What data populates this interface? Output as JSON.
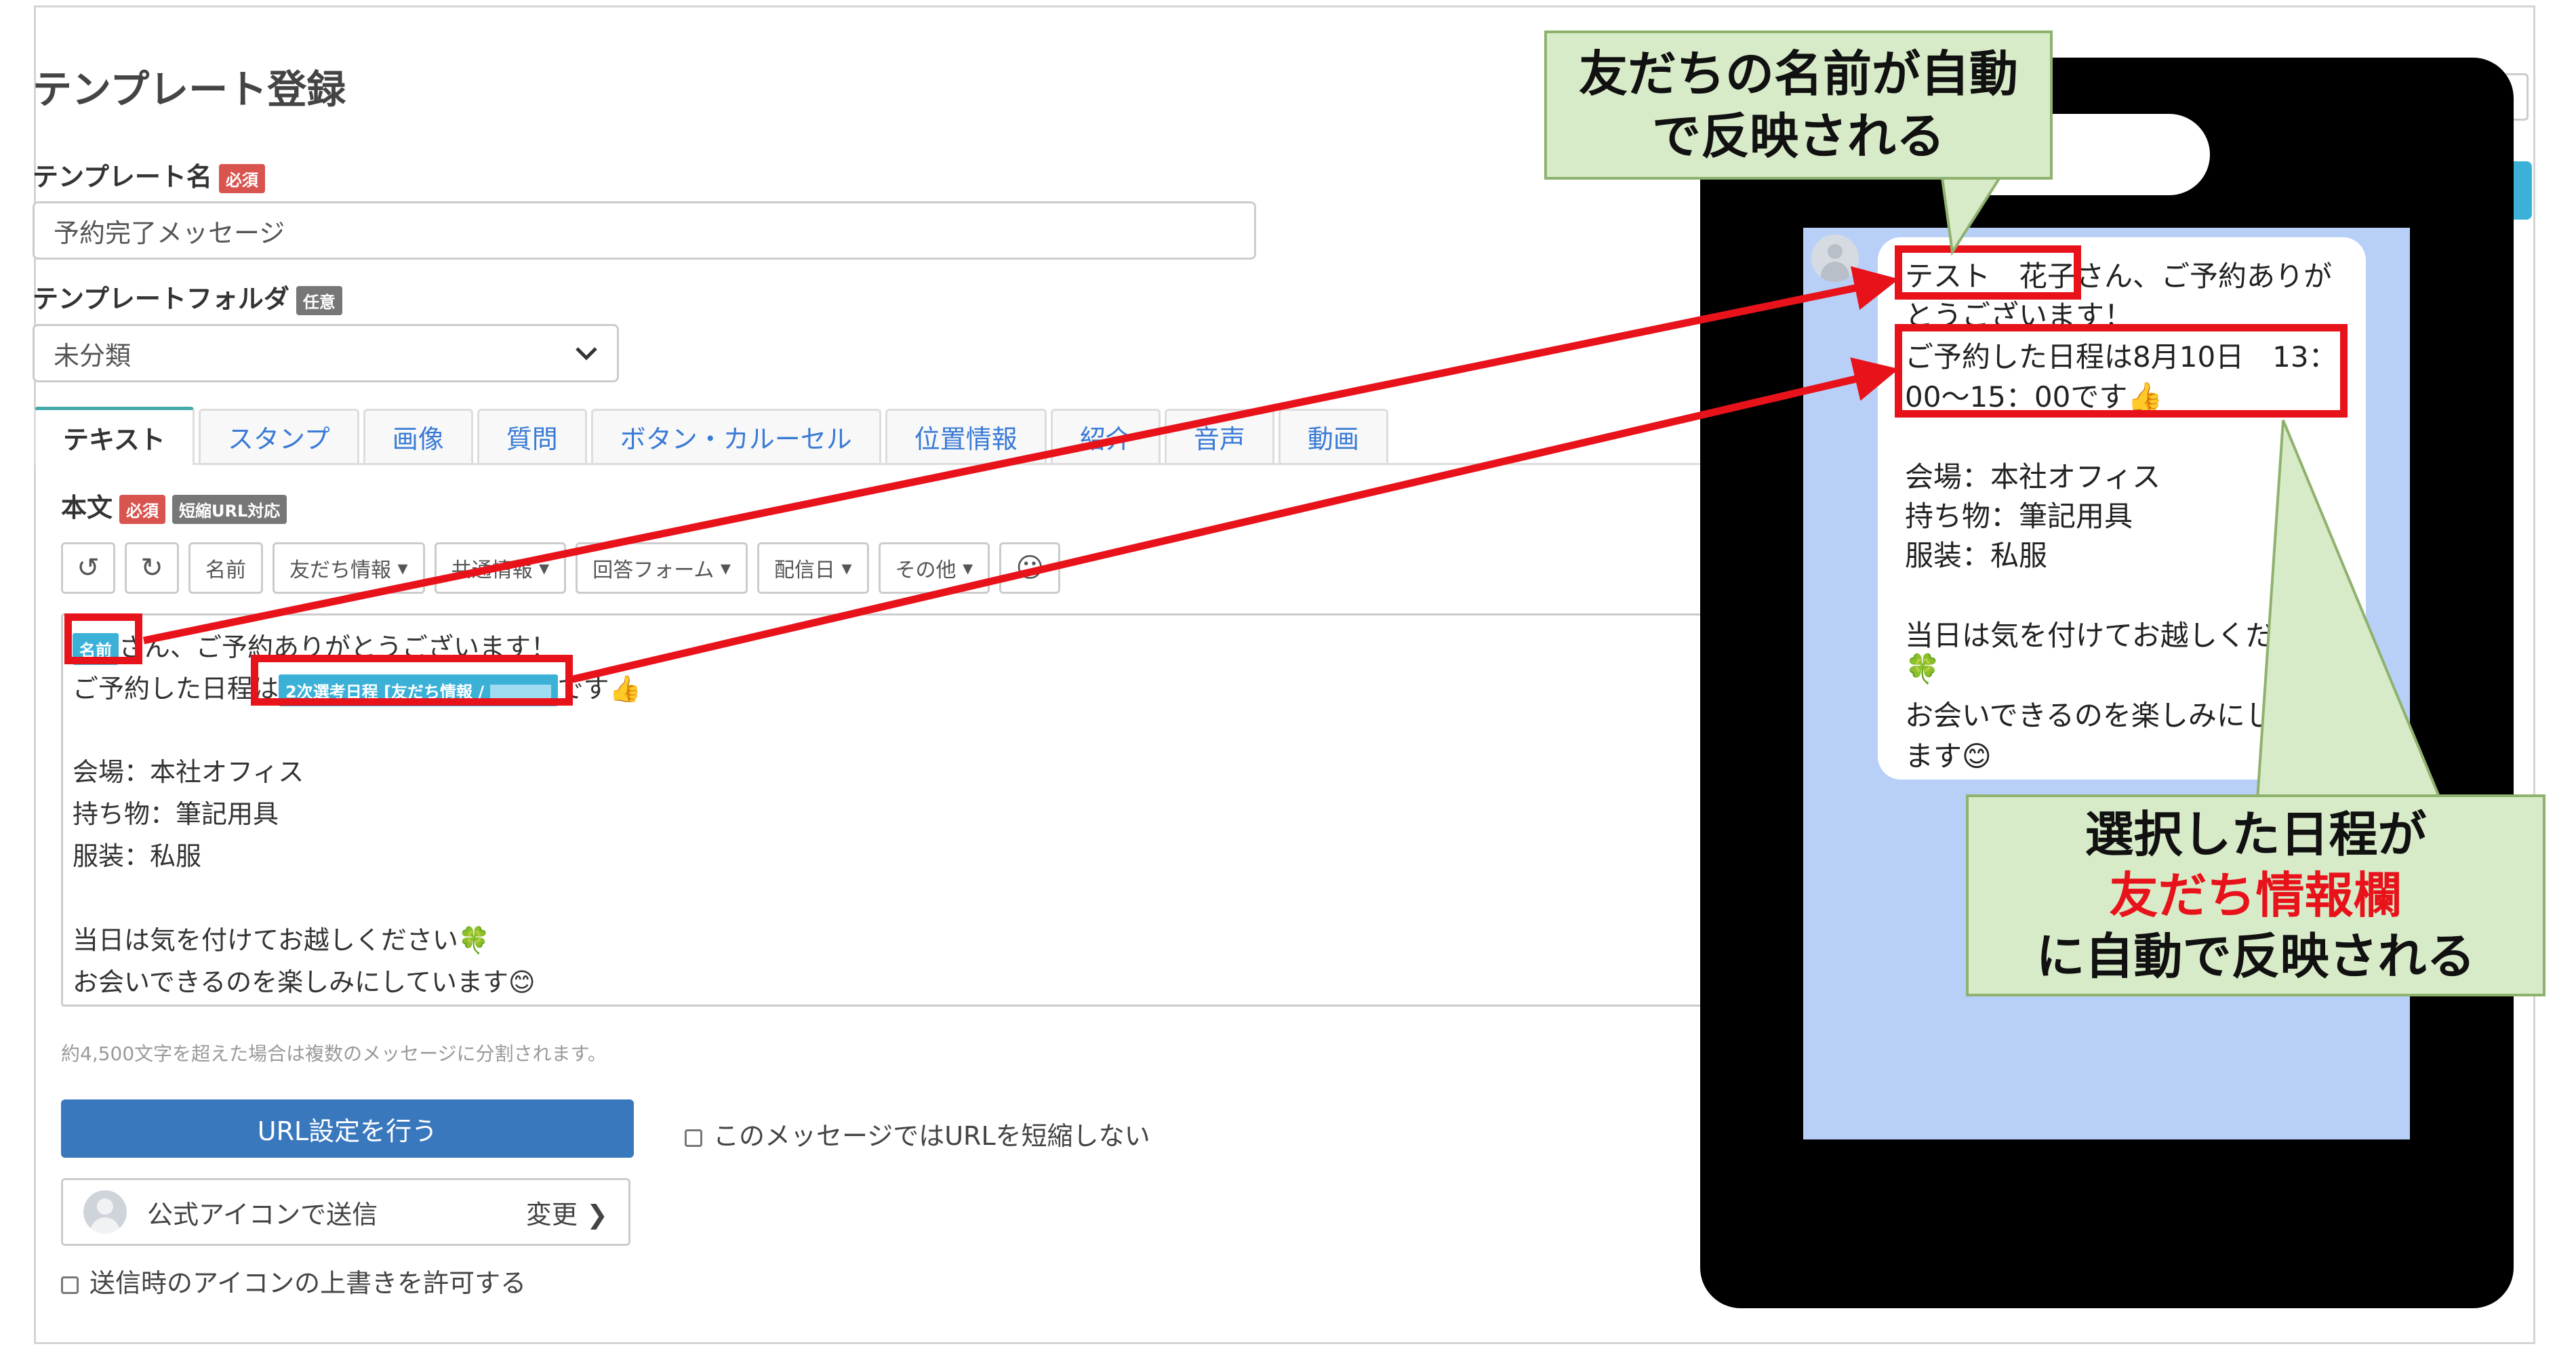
{
  "page": {
    "title": "テンプレート登録",
    "template_name": {
      "label": "テンプレート名",
      "badge": "必須",
      "value": "予約完了メッセージ"
    },
    "folder": {
      "label": "テンプレートフォルダ",
      "badge": "任意",
      "selected": "未分類"
    },
    "tabs": [
      "テキスト",
      "スタンプ",
      "画像",
      "質問",
      "ボタン・カルーセル",
      "位置情報",
      "紹介",
      "音声",
      "動画"
    ],
    "body": {
      "label": "本文",
      "badge_required": "必須",
      "badge_url": "短縮URL対応"
    },
    "toolbar": {
      "undo_icon": "↺",
      "redo_icon": "↻",
      "name": "名前",
      "friend_info": "友だち情報",
      "common_info": "共通情報",
      "answer_form": "回答フォーム",
      "delivery_date": "配信日",
      "other": "その他",
      "emoji_icon": "☺"
    },
    "editor": {
      "name_tag": "名前",
      "line1_after": "さん、ご予約ありがとうございます！",
      "line2_before": "ご予約した日程は",
      "line2_tag": "2次選考日程 [友だち情報 / ",
      "line2_after": "です👍",
      "line3": "会場：本社オフィス",
      "line4": "持ち物：筆記用具",
      "line5": "服装：私服",
      "line6": "当日は気を付けてお越しください🍀",
      "line7": "お会いできるのを楽しみにしています😊"
    },
    "hint": "約4,500文字を超えた場合は複数のメッセージに分割されます。",
    "url_button": "URL設定を行う",
    "no_shorten_checkbox": "このメッセージではURLを短縮しない",
    "sender": {
      "label": "公式アイコンで送信",
      "change": "変更"
    },
    "icon_override_checkbox": "送信時のアイコンの上書きを許可する"
  },
  "preview": {
    "lines": [
      "テスト　花子さん、ご予約ありが",
      "とうございます！",
      "ご予約した日程は8月10日　13：",
      "00～15：00です👍",
      "会場：本社オフィス",
      "持ち物：筆記用具",
      "服装：私服",
      "当日は気を付けてお越しくださ",
      "🍀",
      "お会いできるのを楽しみにして",
      "ます😊"
    ]
  },
  "callouts": {
    "top": {
      "line1": "友だちの名前が自動",
      "line2": "で反映される"
    },
    "bottom": {
      "line1": "選択した日程が",
      "line2": "友だち情報欄",
      "line3": "に自動で反映される"
    }
  },
  "colors": {
    "accent_red": "#e8121b",
    "callout_bg": "#d8ebc8",
    "primary": "#3a78be",
    "tag": "#3bb1d8"
  }
}
